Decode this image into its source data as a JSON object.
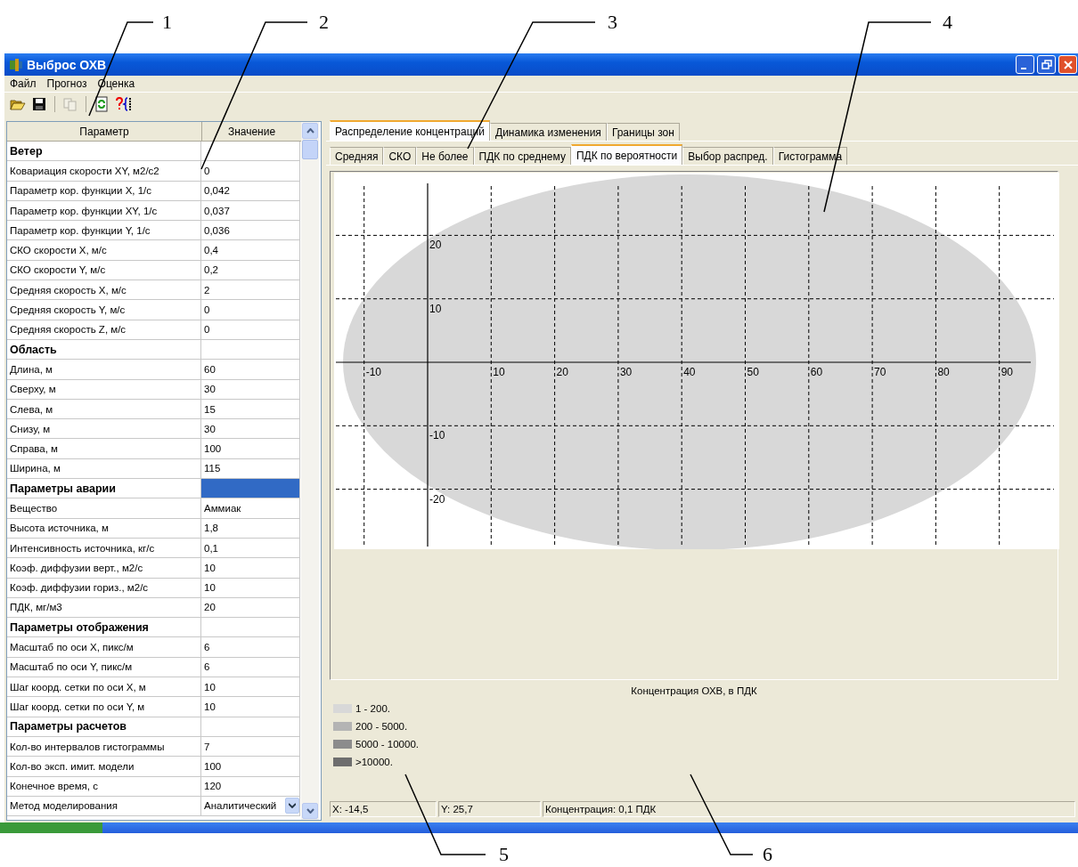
{
  "callouts": [
    {
      "label": "1"
    },
    {
      "label": "2"
    },
    {
      "label": "3"
    },
    {
      "label": "4"
    },
    {
      "label": "5"
    },
    {
      "label": "6"
    }
  ],
  "window": {
    "title": "Выброс ОХВ"
  },
  "menu": [
    "Файл",
    "Прогноз",
    "Оценка"
  ],
  "toolbar": [
    {
      "disabled": false
    },
    {
      "disabled": false
    },
    {
      "disabled": true
    },
    {
      "disabled": false
    },
    {
      "disabled": false
    }
  ],
  "table": {
    "columns": [
      "Параметр",
      "Значение"
    ],
    "rows": [
      {
        "kind": "group",
        "name": "Ветер",
        "selected": false
      },
      {
        "kind": "param",
        "name": "Ковариация скорости XY, м2/с2",
        "value": "0",
        "selected": false
      },
      {
        "kind": "param",
        "name": "Параметр кор. функции X, 1/с",
        "value": "0,042",
        "selected": false
      },
      {
        "kind": "param",
        "name": "Параметр кор. функции XY, 1/с",
        "value": "0,037",
        "selected": false
      },
      {
        "kind": "param",
        "name": "Параметр кор. функции Y, 1/с",
        "value": "0,036",
        "selected": false
      },
      {
        "kind": "param",
        "name": "СКО скорости X, м/с",
        "value": "0,4",
        "selected": false
      },
      {
        "kind": "param",
        "name": "СКО скорости Y, м/с",
        "value": "0,2",
        "selected": false
      },
      {
        "kind": "param",
        "name": "Средняя скорость X, м/с",
        "value": "2",
        "selected": false
      },
      {
        "kind": "param",
        "name": "Средняя скорость Y, м/с",
        "value": "0",
        "selected": false
      },
      {
        "kind": "param",
        "name": "Средняя скорость Z, м/с",
        "value": "0",
        "selected": false
      },
      {
        "kind": "group",
        "name": "Область",
        "selected": false
      },
      {
        "kind": "param",
        "name": "Длина, м",
        "value": "60",
        "selected": false
      },
      {
        "kind": "param",
        "name": "Сверху, м",
        "value": "30",
        "selected": false
      },
      {
        "kind": "param",
        "name": "Слева, м",
        "value": "15",
        "selected": false
      },
      {
        "kind": "param",
        "name": "Снизу, м",
        "value": "30",
        "selected": false
      },
      {
        "kind": "param",
        "name": "Справа, м",
        "value": "100",
        "selected": false
      },
      {
        "kind": "param",
        "name": "Ширина, м",
        "value": "115",
        "selected": false
      },
      {
        "kind": "group",
        "name": "Параметры аварии",
        "selected": true
      },
      {
        "kind": "param",
        "name": "Вещество",
        "value": "Аммиак",
        "selected": false
      },
      {
        "kind": "param",
        "name": "Высота источника, м",
        "value": "1,8",
        "selected": false
      },
      {
        "kind": "param",
        "name": "Интенсивность источника, кг/с",
        "value": "0,1",
        "selected": false
      },
      {
        "kind": "param",
        "name": "Коэф. диффузии верт., м2/с",
        "value": "10",
        "selected": false
      },
      {
        "kind": "param",
        "name": "Коэф. диффузии гориз., м2/с",
        "value": "10",
        "selected": false
      },
      {
        "kind": "param",
        "name": "ПДК, мг/м3",
        "value": "20",
        "selected": false
      },
      {
        "kind": "group",
        "name": "Параметры отображения",
        "selected": false
      },
      {
        "kind": "param",
        "name": "Масштаб по оси X, пикс/м",
        "value": "6",
        "selected": false
      },
      {
        "kind": "param",
        "name": "Масштаб по оси Y, пикс/м",
        "value": "6",
        "selected": false
      },
      {
        "kind": "param",
        "name": "Шаг коорд. сетки по оси X, м",
        "value": "10",
        "selected": false
      },
      {
        "kind": "param",
        "name": "Шаг коорд. сетки по оси Y, м",
        "value": "10",
        "selected": false
      },
      {
        "kind": "group",
        "name": "Параметры расчетов",
        "selected": false
      },
      {
        "kind": "param",
        "name": "Кол-во интервалов гистограммы",
        "value": "7",
        "selected": false
      },
      {
        "kind": "param",
        "name": "Кол-во эксп. имит. модели",
        "value": "100",
        "selected": false
      },
      {
        "kind": "param",
        "name": "Конечное время, с",
        "value": "120",
        "selected": false
      },
      {
        "kind": "dropdown",
        "name": "Метод моделирования",
        "value": "Аналитический",
        "selected": false
      }
    ]
  },
  "tabs": [
    {
      "label": "Распределение концентраций",
      "selected": true
    },
    {
      "label": "Динамика изменения",
      "selected": false
    },
    {
      "label": "Границы зон",
      "selected": false
    }
  ],
  "subtabs": [
    {
      "label": "Средняя",
      "selected": false
    },
    {
      "label": "СКО",
      "selected": false
    },
    {
      "label": "Не более",
      "selected": false
    },
    {
      "label": "ПДК по среднему",
      "selected": false
    },
    {
      "label": "ПДК по вероятности",
      "selected": true
    },
    {
      "label": "Выбор распред.",
      "selected": false
    },
    {
      "label": "Гистограмма",
      "selected": false
    }
  ],
  "plot": {
    "x_labels": [
      "-10",
      "10",
      "20",
      "30",
      "40",
      "50",
      "60",
      "70",
      "80",
      "90"
    ],
    "y_labels": [
      "20",
      "10",
      "-10",
      "-20"
    ]
  },
  "legend": {
    "title": "Концентрация ОХВ, в ПДК",
    "items": [
      {
        "label": "1 - 200.",
        "color": "#d8d8d8"
      },
      {
        "label": "200 - 5000.",
        "color": "#b4b4b4"
      },
      {
        "label": "5000 - 10000.",
        "color": "#8c8c8c"
      },
      {
        "label": ">10000.",
        "color": "#6e6e6e"
      }
    ]
  },
  "status_bar": [
    "X: -14,5",
    "Y: 25,7",
    "Концентрация: 0,1 ПДК"
  ]
}
